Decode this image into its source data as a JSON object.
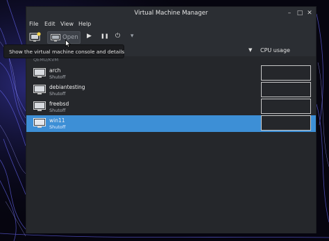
{
  "window": {
    "title": "Virtual Machine Manager",
    "minimize_glyph": "–",
    "maximize_glyph": "□",
    "close_glyph": "✕"
  },
  "menu": [
    "File",
    "Edit",
    "View",
    "Help"
  ],
  "toolbar": {
    "open_label": "Open",
    "run_glyph": "▶",
    "pause_glyph": "❚❚",
    "shutdown_glyph": "⏻",
    "dropdown_glyph": "▾"
  },
  "header": {
    "sort_glyph": "▼",
    "cpu_label": "CPU usage"
  },
  "list": {
    "group_label": "QEMU/KVM",
    "vms": [
      {
        "name": "arch",
        "status": "Shutoff",
        "selected": false
      },
      {
        "name": "debiantesting",
        "status": "Shutoff",
        "selected": false
      },
      {
        "name": "freebsd",
        "status": "Shutoff",
        "selected": false
      },
      {
        "name": "win11",
        "status": "Shutoff",
        "selected": true
      }
    ]
  },
  "tooltip": "Show the virtual machine console and details",
  "colors": {
    "selection": "#3d8fd6",
    "window_bg": "#2b2e33",
    "list_bg": "#25272b"
  },
  "icons": [
    "new-vm-icon",
    "monitor-icon",
    "run-icon",
    "pause-icon",
    "power-icon",
    "chevron-down-icon",
    "vm-monitor-icon",
    "mouse-cursor-icon"
  ]
}
